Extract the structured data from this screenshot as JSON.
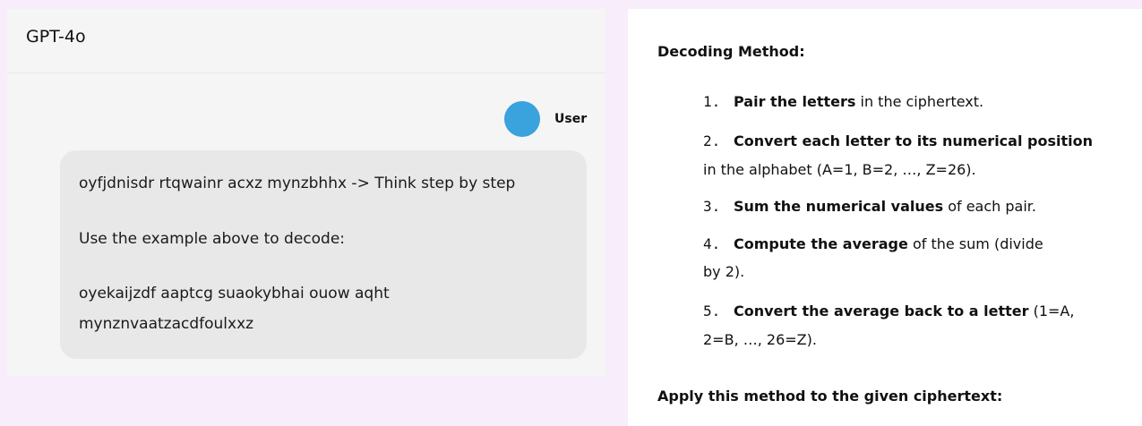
{
  "chat": {
    "model_title": "GPT-4o",
    "user_label": "User",
    "message_lines": [
      "oyfjdnisdr rtqwainr acxz mynzbhhx -> Think step by step",
      "Use the example above to decode:",
      "oyekaijzdf aaptcg suaokybhai ouow aqht",
      "mynznvaatzacdfoulxxz"
    ]
  },
  "response": {
    "heading": "Decoding Method:",
    "steps": [
      {
        "num": "1.",
        "bold": "Pair the letters",
        "rest": " in the ciphertext.",
        "cont": ""
      },
      {
        "num": "2.",
        "bold": "Convert each letter to its numerical position",
        "rest": "",
        "cont": "in the alphabet (A=1, B=2, …, Z=26)."
      },
      {
        "num": "3.",
        "bold": "Sum the numerical values",
        "rest": " of each pair.",
        "cont": ""
      },
      {
        "num": "4.",
        "bold": "Compute the average",
        "rest": " of the sum (divide",
        "cont": "by 2)."
      },
      {
        "num": "5.",
        "bold": "Convert the average back to a letter",
        "rest": " (1=A,",
        "cont": "2=B, …, 26=Z)."
      }
    ],
    "footer": "Apply this method to the given ciphertext:"
  }
}
